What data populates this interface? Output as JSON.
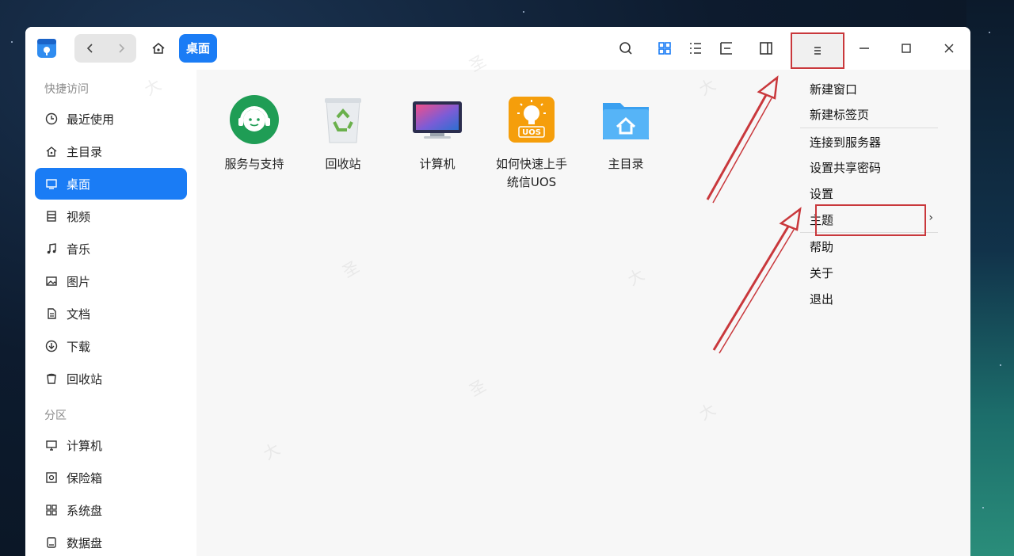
{
  "breadcrumb": {
    "current": "桌面"
  },
  "sidebar": {
    "sections": [
      {
        "label": "快捷访问"
      },
      {
        "label": "分区"
      }
    ],
    "items": [
      {
        "label": "最近使用",
        "icon": "clock-icon"
      },
      {
        "label": "主目录",
        "icon": "home-icon"
      },
      {
        "label": "桌面",
        "icon": "desktop-icon",
        "active": true
      },
      {
        "label": "视频",
        "icon": "video-icon"
      },
      {
        "label": "音乐",
        "icon": "music-icon"
      },
      {
        "label": "图片",
        "icon": "picture-icon"
      },
      {
        "label": "文档",
        "icon": "document-icon"
      },
      {
        "label": "下载",
        "icon": "download-icon"
      },
      {
        "label": "回收站",
        "icon": "trash-icon"
      },
      {
        "label": "计算机",
        "icon": "computer-icon"
      },
      {
        "label": "保险箱",
        "icon": "vault-icon"
      },
      {
        "label": "系统盘",
        "icon": "disk-icon"
      },
      {
        "label": "数据盘",
        "icon": "disk-icon"
      }
    ]
  },
  "files": [
    {
      "label": "服务与支持",
      "icon": "support-icon"
    },
    {
      "label": "回收站",
      "icon": "recycle-bin-icon"
    },
    {
      "label": "计算机",
      "icon": "computer-icon"
    },
    {
      "label": "如何快速上手统信UOS",
      "label_line1": "如何快速上手",
      "label_line2": "统信UOS",
      "badge": "UOS",
      "icon": "lightbulb-icon"
    },
    {
      "label": "主目录",
      "icon": "home-folder-icon"
    }
  ],
  "menu": {
    "items": [
      {
        "label": "新建窗口"
      },
      {
        "label": "新建标签页"
      },
      {
        "label": "连接到服务器"
      },
      {
        "label": "设置共享密码"
      },
      {
        "label": "设置"
      },
      {
        "label": "主题",
        "submenu_arrow": "›"
      },
      {
        "label": "帮助"
      },
      {
        "label": "关于"
      },
      {
        "label": "退出"
      }
    ]
  },
  "colors": {
    "accent": "#1a7cf5",
    "annotation_red": "#c9383c"
  }
}
